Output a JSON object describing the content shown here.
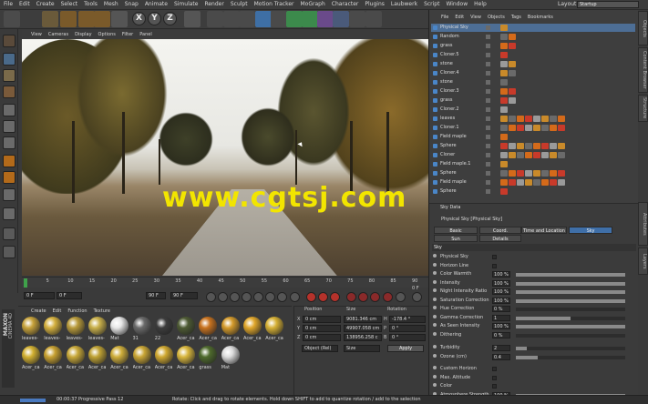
{
  "menubar": {
    "items": [
      "File",
      "Edit",
      "Create",
      "Select",
      "Tools",
      "Mesh",
      "Snap",
      "Animate",
      "Simulate",
      "Render",
      "Sculpt",
      "Motion Tracker",
      "MoGraph",
      "Character",
      "Plugins",
      "Laubwerk",
      "Script",
      "Window",
      "Help"
    ],
    "layout_label": "Layout:",
    "layout_value": "Startup"
  },
  "toolbar": {
    "axes": [
      "X",
      "Y",
      "Z"
    ]
  },
  "viewport": {
    "menu": [
      "View",
      "Cameras",
      "Display",
      "Options",
      "Filter",
      "Panel"
    ]
  },
  "watermark": "www.cgtsj.com",
  "timeline": {
    "ticks": [
      "0",
      "5",
      "10",
      "15",
      "20",
      "25",
      "30",
      "35",
      "40",
      "45",
      "50",
      "55",
      "60",
      "65",
      "70",
      "75",
      "80",
      "85",
      "90"
    ],
    "frame_end_label": "0 F",
    "field_start": "0 F",
    "field_current": "0 F",
    "field_end": "90 F",
    "field_max": "90 F"
  },
  "material_manager": {
    "menu": [
      "Create",
      "Edit",
      "Function",
      "Texture"
    ],
    "materials_row1": [
      "leaves-",
      "leaves-",
      "leaves-",
      "leaves-",
      "Mat",
      "31",
      "22",
      "Acer_ca",
      "Acer_ca",
      "Acer_ca",
      "Acer_ca",
      "Acer_ca"
    ],
    "materials_row2": [
      "Acer_ca",
      "Acer_ca",
      "Acer_ca",
      "Acer_ca",
      "Acer_ca",
      "Acer_ca",
      "Acer_ca",
      "Acer_ca",
      "grass",
      "Mat"
    ]
  },
  "coordinates": {
    "headers": [
      "Position",
      "Size",
      "Rotation"
    ],
    "rows": [
      {
        "axis": "X",
        "pos": "0 cm",
        "size": "9081.346 cm",
        "rot_axis": "H",
        "rot": "-178.4 °"
      },
      {
        "axis": "Y",
        "pos": "0 cm",
        "size": "49907.058 cm",
        "rot_axis": "P",
        "rot": "0 °"
      },
      {
        "axis": "Z",
        "pos": "0 cm",
        "size": "138956.258 c",
        "rot_axis": "B",
        "rot": "0 °"
      }
    ],
    "mode": "Object (Rel)",
    "size_mode": "Size",
    "apply": "Apply"
  },
  "object_manager": {
    "menu": [
      "File",
      "Edit",
      "View",
      "Objects",
      "Tags",
      "Bookmarks"
    ],
    "objects": [
      {
        "name": "Physical Sky",
        "selected": true
      },
      {
        "name": "Random",
        "selected": false
      },
      {
        "name": "grass",
        "selected": false
      },
      {
        "name": "Cloner.5",
        "selected": false
      },
      {
        "name": "stone",
        "selected": false
      },
      {
        "name": "Cloner.4",
        "selected": false
      },
      {
        "name": "stone",
        "selected": false
      },
      {
        "name": "Cloner.3",
        "selected": false
      },
      {
        "name": "grass",
        "selected": false
      },
      {
        "name": "Cloner.2",
        "selected": false
      },
      {
        "name": "leaves",
        "selected": false
      },
      {
        "name": "Cloner.1",
        "selected": false
      },
      {
        "name": "Field maple",
        "selected": false
      },
      {
        "name": "Sphere",
        "selected": false
      },
      {
        "name": "Cloner",
        "selected": false
      },
      {
        "name": "Field maple.1",
        "selected": false
      },
      {
        "name": "Sphere",
        "selected": false
      },
      {
        "name": "Field maple",
        "selected": false
      },
      {
        "name": "Sphere",
        "selected": false
      }
    ]
  },
  "attributes": {
    "header": "Sky Data",
    "object_title": "Physical Sky [Physical Sky]",
    "tabs": [
      "Basic",
      "Coord.",
      "Time and Location",
      "Sky",
      "Sun",
      "Details"
    ],
    "active_tab": "Sky",
    "section": "Sky",
    "rows": [
      {
        "label": "Physical Sky",
        "value": "",
        "pct": null
      },
      {
        "label": "Horizon Line",
        "value": "",
        "pct": null
      },
      {
        "label": "Color Warmth",
        "value": "100 %",
        "pct": 100
      },
      {
        "label": "Intensity",
        "value": "100 %",
        "pct": 100
      },
      {
        "label": "Night Intensity Ratio",
        "value": "100 %",
        "pct": 100
      },
      {
        "label": "Saturation Correction",
        "value": "100 %",
        "pct": 100
      },
      {
        "label": "Hue Correction",
        "value": "0 %",
        "pct": 0
      },
      {
        "label": "Gamma Correction",
        "value": "1",
        "pct": 50
      },
      {
        "label": "As Seen Intensity",
        "value": "100 %",
        "pct": 100
      },
      {
        "label": "Dithering",
        "value": "0 %",
        "pct": 0
      },
      {
        "label": "Turbidity",
        "value": "2",
        "pct": 10
      },
      {
        "label": "Ozone (cm)",
        "value": "0.4",
        "pct": 20
      },
      {
        "label": "Custom Horizon",
        "value": "",
        "pct": null
      },
      {
        "label": "Max. Altitude",
        "value": "",
        "pct": null
      },
      {
        "label": "Color",
        "value": "",
        "pct": null
      },
      {
        "label": "Atmosphere Strength",
        "value": "100 %",
        "pct": 100
      }
    ]
  },
  "side_tabs": [
    "Objects",
    "Content Browser",
    "Structure",
    "Attributes",
    "Layers"
  ],
  "statusbar": {
    "time": "00:00:37 Progressive Pass 12",
    "hint": "Rotate: Click and drag to rotate elements. Hold down SHIFT to add to quantize rotation / add to the selection"
  },
  "brand": {
    "line1": "MAXON",
    "line2": "CINEMA 4D"
  },
  "colors": {
    "accent_blue": "#3f6fa8",
    "watermark": "#f2e500",
    "selected_row": "#4d6e95"
  }
}
